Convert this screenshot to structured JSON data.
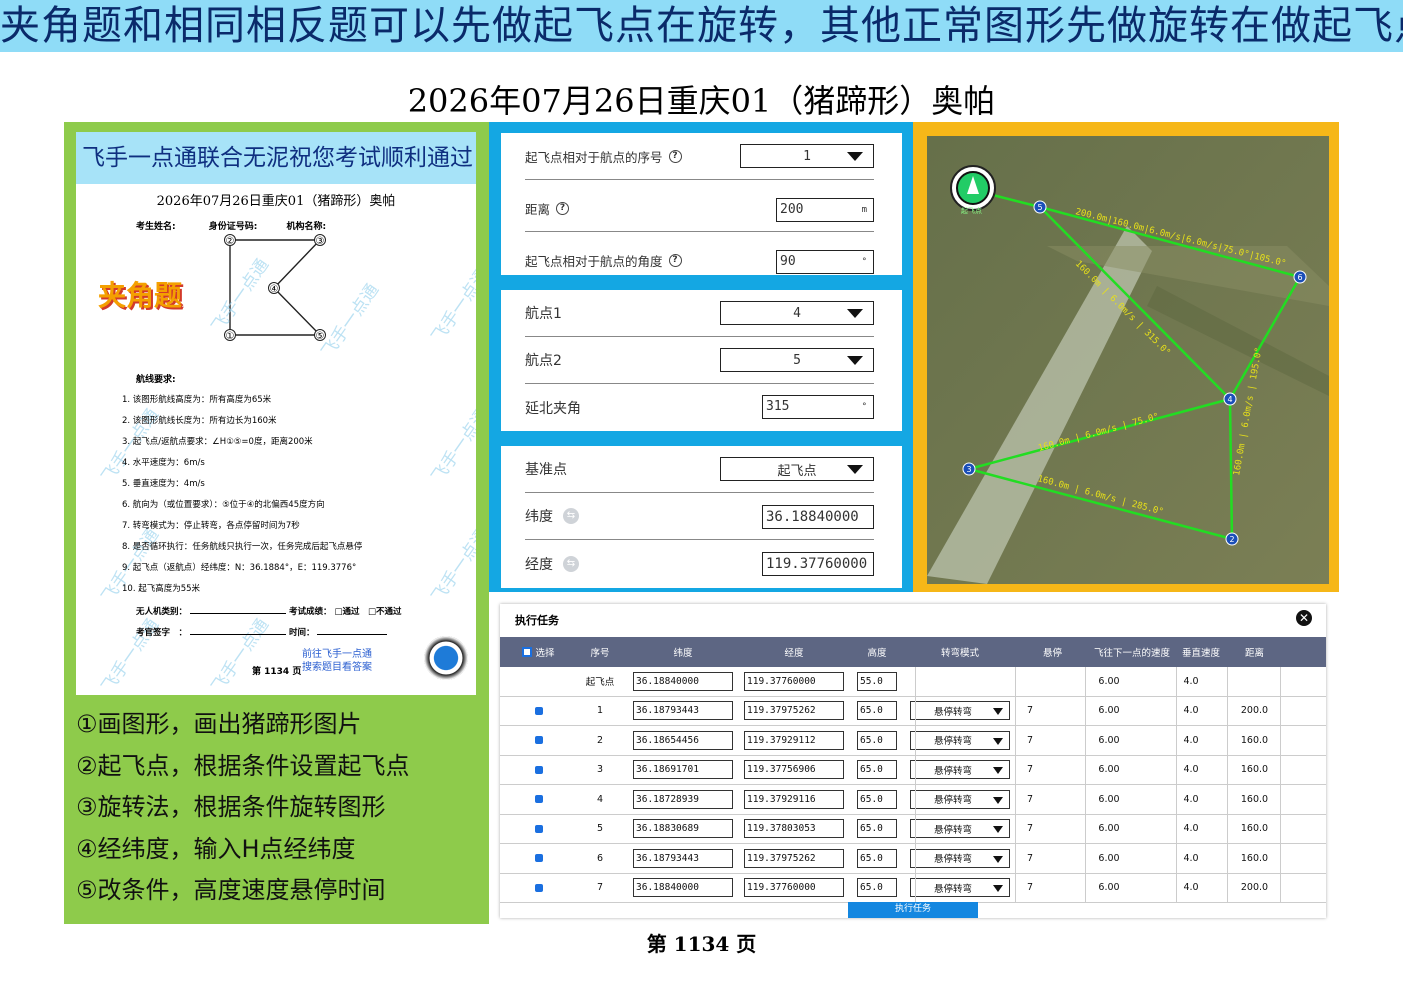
{
  "banner": "夹角题和相同相反题可以先做起飞点在旋转，其他正常图形先做旋转在做起飞点",
  "subtitle": "2026年07月26日重庆01（猪蹄形）奥帕",
  "doc": {
    "header": "飞手一点通联合无泥祝您考试顺利通过",
    "title": "2026年07月26日重庆01（猪蹄形）奥帕",
    "fields": [
      "考生姓名:",
      "身份证号码:",
      "机构名称:"
    ],
    "tag": "夹角题",
    "requirements_title": "航线要求:",
    "requirements": [
      "1.  该图形航线高度为：所有高度为65米",
      "2.  该图形航线长度为：所有边长为160米",
      "3.  起飞点/返航点要求：∠H①⑤=0度，距离200米",
      "4.  水平速度为：6m/s",
      "5.  垂直速度为：4m/s",
      "6.  航向为（或位置要求）：⑤位于④的北偏西45度方向",
      "7.  转弯模式为：停止转弯，各点停留时间为7秒",
      "8.  是否循环执行：任务航线只执行一次，任务完成后起飞点悬停",
      "9.  起飞点（返航点）经纬度：N：36.1884°，E：119.3776°",
      "10. 起飞高度为55米"
    ],
    "sign1_a": "无人机类别：",
    "sign1_b": "考试成绩：",
    "sign1_c": "□通过　□不通过",
    "sign2_a": "考官签字　：",
    "sign2_b": "时间：",
    "promo1": "前往飞手一点通",
    "promo2": "搜索题目看答案",
    "page": "第 1134 页",
    "watermark": "飞手一点通",
    "points": [
      "①",
      "②",
      "③",
      "④",
      "⑤"
    ]
  },
  "steps": [
    "①画图形，画出猪蹄形图片",
    "②起飞点，根据条件设置起飞点",
    "③旋转法，根据条件旋转图形",
    "④经纬度，输入H点经纬度",
    "⑤改条件，高度速度悬停时间"
  ],
  "card1": {
    "seq_label": "起飞点相对于航点的序号",
    "seq_value": "1",
    "dist_label": "距离",
    "dist_value": "200",
    "dist_unit": "m",
    "angle_label": "起飞点相对于航点的角度",
    "angle_value": "90",
    "angle_unit": "°"
  },
  "card2": {
    "wp1_label": "航点1",
    "wp1_value": "4",
    "wp2_label": "航点2",
    "wp2_value": "5",
    "ang_label": "延北夹角",
    "ang_value": "315",
    "ang_unit": "°"
  },
  "card3": {
    "base_label": "基准点",
    "base_value": "起飞点",
    "lat_label": "纬度",
    "lat_value": "36.18840000",
    "lon_label": "经度",
    "lon_value": "119.37760000"
  },
  "map": {
    "home_label": "起飞点",
    "waypoints": [
      "5",
      "6",
      "4",
      "3",
      "2"
    ],
    "seg_labels": [
      "200.0m|160.0m|6.0m/s|6.0m/s|75.0°|105.0°",
      "160.0m | 6.0m/s | 315.0°",
      "160.0m | 6.0m/s | 195.0°",
      "160.0m | 6.0m/s | 75.0°",
      "160.0m | 6.0m/s | 285.0°"
    ]
  },
  "task": {
    "title": "执行任务",
    "close": "✕",
    "headers": [
      "选择",
      "序号",
      "纬度",
      "经度",
      "高度",
      "转弯模式",
      "悬停",
      "飞往下一点的速度",
      "垂直速度",
      "距离"
    ],
    "home_row": {
      "seq": "起飞点",
      "lat": "36.18840000",
      "lon": "119.37760000",
      "alt": "55.0",
      "speed": "6.00",
      "vspeed": "4.0"
    },
    "rows": [
      {
        "seq": "1",
        "lat": "36.18793443",
        "lon": "119.37975262",
        "alt": "65.0",
        "turn": "悬停转弯",
        "hover": "7",
        "speed": "6.00",
        "vspeed": "4.0",
        "dist": "200.0"
      },
      {
        "seq": "2",
        "lat": "36.18654456",
        "lon": "119.37929112",
        "alt": "65.0",
        "turn": "悬停转弯",
        "hover": "7",
        "speed": "6.00",
        "vspeed": "4.0",
        "dist": "160.0"
      },
      {
        "seq": "3",
        "lat": "36.18691701",
        "lon": "119.37756906",
        "alt": "65.0",
        "turn": "悬停转弯",
        "hover": "7",
        "speed": "6.00",
        "vspeed": "4.0",
        "dist": "160.0"
      },
      {
        "seq": "4",
        "lat": "36.18728939",
        "lon": "119.37929116",
        "alt": "65.0",
        "turn": "悬停转弯",
        "hover": "7",
        "speed": "6.00",
        "vspeed": "4.0",
        "dist": "160.0"
      },
      {
        "seq": "5",
        "lat": "36.18830689",
        "lon": "119.37803053",
        "alt": "65.0",
        "turn": "悬停转弯",
        "hover": "7",
        "speed": "6.00",
        "vspeed": "4.0",
        "dist": "160.0"
      },
      {
        "seq": "6",
        "lat": "36.18793443",
        "lon": "119.37975262",
        "alt": "65.0",
        "turn": "悬停转弯",
        "hover": "7",
        "speed": "6.00",
        "vspeed": "4.0",
        "dist": "160.0"
      },
      {
        "seq": "7",
        "lat": "36.18840000",
        "lon": "119.37760000",
        "alt": "65.0",
        "turn": "悬停转弯",
        "hover": "7",
        "speed": "6.00",
        "vspeed": "4.0",
        "dist": "200.0"
      }
    ],
    "exec_button": "执行任务"
  },
  "footer": "第 1134 页",
  "colors": {
    "banner": "#8fdcf7",
    "left_panel": "#8ecb4b",
    "mid_panel": "#14a7e3",
    "right_panel": "#f6b718",
    "route": "#22dd22",
    "table_header": "#5d6683"
  }
}
